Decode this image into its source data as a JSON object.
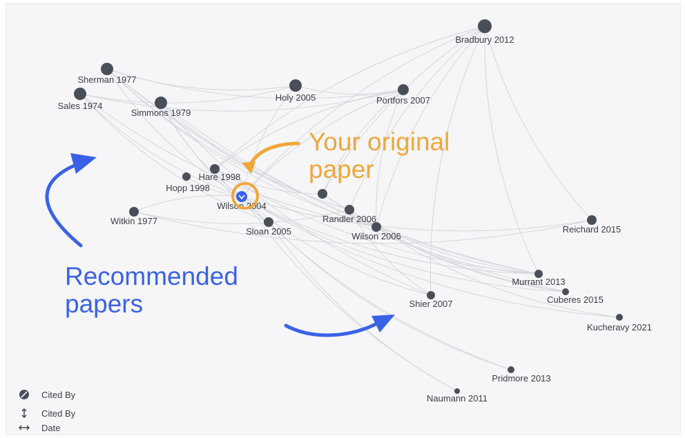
{
  "graph": {
    "nodes": [
      {
        "id": "bradbury2012",
        "label": "Bradbury 2012"
      },
      {
        "id": "sherman1977",
        "label": "Sherman 1977"
      },
      {
        "id": "sales1974",
        "label": "Sales 1974"
      },
      {
        "id": "simmons1979",
        "label": "Simmons 1979"
      },
      {
        "id": "holy2005",
        "label": "Holy 2005"
      },
      {
        "id": "portfors2007",
        "label": "Portfors 2007"
      },
      {
        "id": "hare1998",
        "label": "Hare 1998"
      },
      {
        "id": "hopp1998",
        "label": "Hopp 1998"
      },
      {
        "id": "wilson2004",
        "label": "Wilson 2004"
      },
      {
        "id": "witkin1977",
        "label": "Witkin 1977"
      },
      {
        "id": "sloan2005",
        "label": "Sloan 2005"
      },
      {
        "id": "unlabeled1",
        "label": ""
      },
      {
        "id": "randler2006",
        "label": "Randler 2006"
      },
      {
        "id": "wilson2006",
        "label": "Wilson 2006"
      },
      {
        "id": "reichard2015",
        "label": "Reichard 2015"
      },
      {
        "id": "murrant2013",
        "label": "Murrant 2013"
      },
      {
        "id": "cuberes2015",
        "label": "Cuberes 2015"
      },
      {
        "id": "shier2007",
        "label": "Shier 2007"
      },
      {
        "id": "kucheravy2021",
        "label": "Kucheravy 2021"
      },
      {
        "id": "pridmore2013",
        "label": "Pridmore 2013"
      },
      {
        "id": "naumann2011",
        "label": "Naumann 2011"
      }
    ],
    "edges": [
      [
        "bradbury2012",
        "hare1998"
      ],
      [
        "bradbury2012",
        "wilson2004"
      ],
      [
        "bradbury2012",
        "randler2006"
      ],
      [
        "bradbury2012",
        "wilson2006"
      ],
      [
        "bradbury2012",
        "reichard2015"
      ],
      [
        "bradbury2012",
        "murrant2013"
      ],
      [
        "bradbury2012",
        "shier2007"
      ],
      [
        "bradbury2012",
        "unlabeled1"
      ],
      [
        "sherman1977",
        "wilson2004"
      ],
      [
        "sherman1977",
        "wilson2006"
      ],
      [
        "sherman1977",
        "randler2006"
      ],
      [
        "sherman1977",
        "murrant2013"
      ],
      [
        "sherman1977",
        "cuberes2015"
      ],
      [
        "sherman1977",
        "holy2005"
      ],
      [
        "sherman1977",
        "portfors2007"
      ],
      [
        "sales1974",
        "portfors2007"
      ],
      [
        "sales1974",
        "wilson2004"
      ],
      [
        "sales1974",
        "sloan2005"
      ],
      [
        "sales1974",
        "wilson2006"
      ],
      [
        "sales1974",
        "holy2005"
      ],
      [
        "simmons1979",
        "wilson2004"
      ],
      [
        "simmons1979",
        "sloan2005"
      ],
      [
        "simmons1979",
        "randler2006"
      ],
      [
        "simmons1979",
        "murrant2013"
      ],
      [
        "simmons1979",
        "shier2007"
      ],
      [
        "holy2005",
        "wilson2004"
      ],
      [
        "holy2005",
        "portfors2007"
      ],
      [
        "portfors2007",
        "wilson2004"
      ],
      [
        "portfors2007",
        "hare1998"
      ],
      [
        "portfors2007",
        "unlabeled1"
      ],
      [
        "portfors2007",
        "wilson2006"
      ],
      [
        "wilson2004",
        "witkin1977"
      ],
      [
        "wilson2004",
        "sloan2005"
      ],
      [
        "wilson2004",
        "reichard2015"
      ],
      [
        "wilson2004",
        "murrant2013"
      ],
      [
        "wilson2004",
        "cuberes2015"
      ],
      [
        "wilson2004",
        "kucheravy2021"
      ],
      [
        "wilson2004",
        "shier2007"
      ],
      [
        "wilson2004",
        "pridmore2013"
      ],
      [
        "wilson2004",
        "naumann2011"
      ],
      [
        "hopp1998",
        "wilson2004"
      ],
      [
        "hare1998",
        "wilson2004"
      ],
      [
        "hare1998",
        "murrant2013"
      ],
      [
        "hare1998",
        "unlabeled1"
      ],
      [
        "witkin1977",
        "randler2006"
      ],
      [
        "witkin1977",
        "reichard2015"
      ],
      [
        "sloan2005",
        "pridmore2013"
      ],
      [
        "sloan2005",
        "naumann2011"
      ],
      [
        "unlabeled1",
        "murrant2013"
      ],
      [
        "unlabeled1",
        "cuberes2015"
      ],
      [
        "randler2006",
        "cuberes2015"
      ],
      [
        "wilson2006",
        "kucheravy2021"
      ],
      [
        "wilson2006",
        "murrant2013"
      ],
      [
        "randler2006",
        "shier2007"
      ]
    ]
  },
  "annotations": {
    "original_line1": "Your original",
    "original_line2": "paper",
    "recommended_line1": "Recommended",
    "recommended_line2": "papers"
  },
  "colors": {
    "node": "#4a4e58",
    "edge": "#d4d6dc",
    "highlight_ring": "#efa73a",
    "selected_node": "#3a62e6",
    "annotation_orange": "#efa73a",
    "annotation_blue": "#3a62e6"
  },
  "legend": [
    {
      "icon": "cited-by-size-icon",
      "label": "Cited By"
    },
    {
      "icon": "cited-by-axis-icon",
      "label": "Cited By"
    },
    {
      "icon": "date-axis-icon",
      "label": "Date"
    }
  ]
}
